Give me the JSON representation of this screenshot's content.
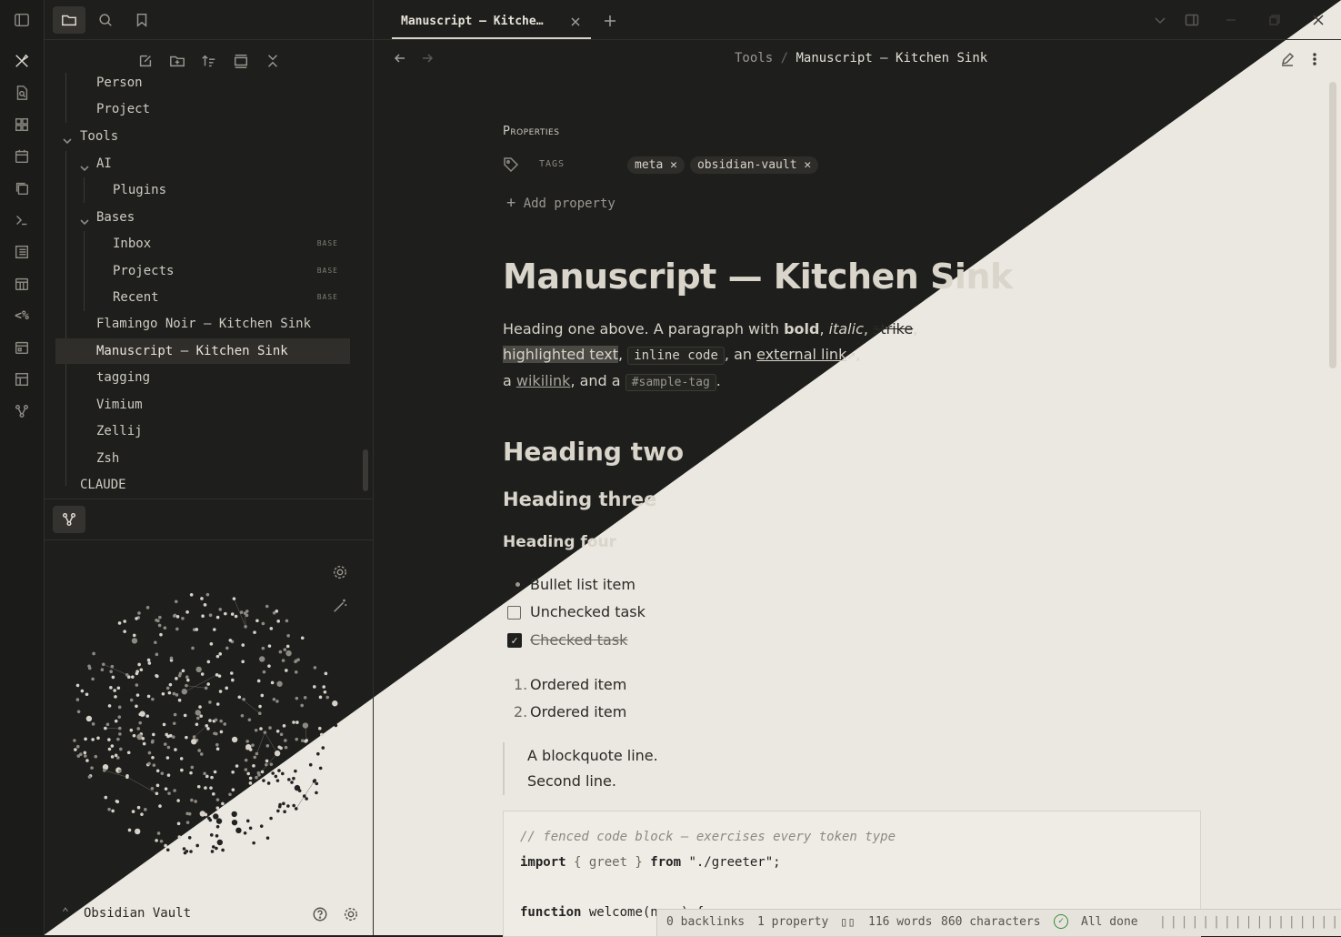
{
  "ribbon": {
    "icons": [
      "sidebar-toggle-icon",
      "pen-tool-icon",
      "file-search-icon",
      "grid-icon",
      "calendar-icon",
      "copy-icon",
      "terminal-icon",
      "list-icon",
      "calendar-grid-icon",
      "code-percent-icon",
      "calendar-day-icon",
      "table-icon",
      "graph-icon"
    ]
  },
  "sidebar": {
    "tree": [
      {
        "label": "Person"
      },
      {
        "label": "Project"
      },
      {
        "label": "Tools"
      },
      {
        "label": "AI"
      },
      {
        "label": "Plugins"
      },
      {
        "label": "Bases"
      },
      {
        "label": "Inbox",
        "badge": "BASE"
      },
      {
        "label": "Projects",
        "badge": "BASE"
      },
      {
        "label": "Recent",
        "badge": "BASE"
      },
      {
        "label": "Flamingo Noir — Kitchen Sink"
      },
      {
        "label": "Manuscript — Kitchen Sink"
      },
      {
        "label": "tagging"
      },
      {
        "label": "Vimium"
      },
      {
        "label": "Zellij"
      },
      {
        "label": "Zsh"
      },
      {
        "label": "CLAUDE"
      }
    ],
    "vault_name": "Obsidian Vault"
  },
  "tab": {
    "title": "Manuscript — Kitche…"
  },
  "breadcrumb": {
    "parent": "Tools",
    "sep": "/",
    "current": "Manuscript — Kitchen Sink"
  },
  "properties": {
    "heading": "Properties",
    "tags_label": "TAGS",
    "tags": [
      "meta",
      "obsidian-vault"
    ],
    "add_property": "Add property"
  },
  "doc": {
    "title": "Manuscript — Kitchen Sink",
    "p1_a": "Heading one above. A paragraph with ",
    "bold": "bold",
    "italic": "italic",
    "strike": "strike",
    "highlight": "highlighted text",
    "inline_code": "inline code",
    "an": ", an ",
    "external_link": "external link",
    "a": "a ",
    "wikilink": "wikilink",
    "and_a": ", and a ",
    "tag": "#sample-tag",
    "h2": "Heading two",
    "h3": "Heading three",
    "h4": "Heading four",
    "bullet": "Bullet list item",
    "task_unchecked": "Unchecked task",
    "task_checked": "Checked task",
    "ol1": "Ordered item",
    "ol2": "Ordered item",
    "quote1": "A blockquote line.",
    "quote2": "Second line.",
    "code_comment": "// fenced code block — exercises every token type",
    "code_import_kw": "import",
    "code_import_rest": " { greet } ",
    "code_from_kw": "from",
    "code_from_rest": " \"./greeter\";",
    "code_fn_kw": "function",
    "code_fn_rest": " welcome(name) {"
  },
  "status": {
    "backlinks": "0 backlinks",
    "property": "1 property",
    "words": "116 words",
    "chars": "860 characters",
    "sync": "All done"
  },
  "colors": {
    "dark_bg": "#1e1e1c",
    "light_bg": "#ebe8e1",
    "accent_check": "#3a8a3a"
  }
}
